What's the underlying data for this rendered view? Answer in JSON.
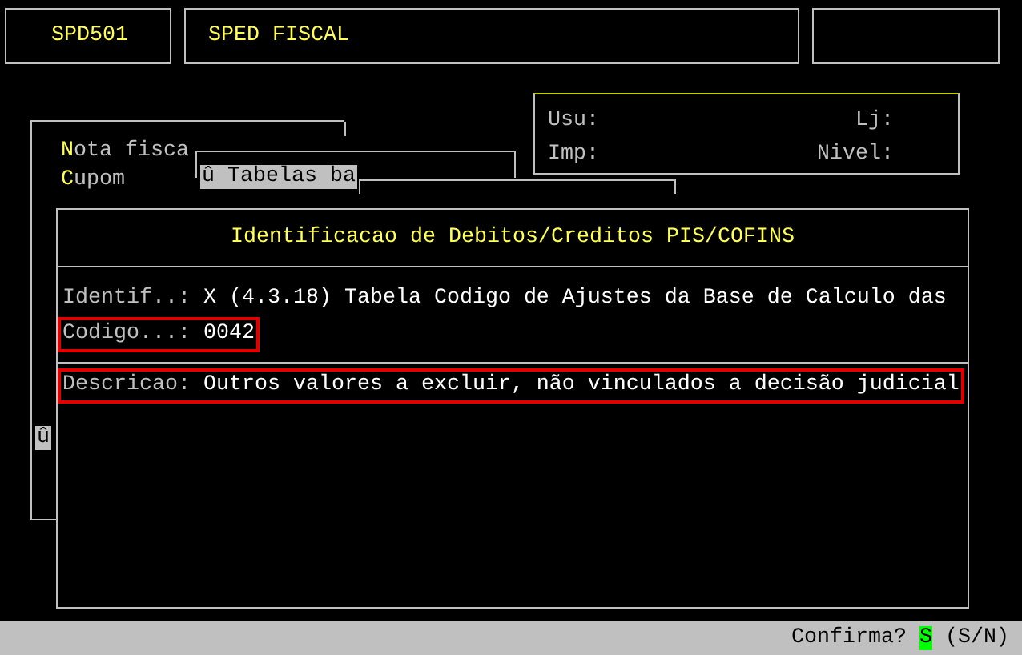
{
  "header": {
    "program_code": "SPD501",
    "program_title": "SPED FISCAL"
  },
  "info_panel": {
    "fields": [
      {
        "label": "Usu:"
      },
      {
        "label": "Lj:"
      },
      {
        "label": "Imp:"
      },
      {
        "label": "Nivel:"
      }
    ]
  },
  "back_menu": {
    "items": [
      "Nota fisca",
      "Cupom"
    ]
  },
  "submenu": {
    "selected_item": "û Tabelas ba"
  },
  "side_marker": "û",
  "dialog": {
    "title": "Identificacao de Debitos/Creditos PIS/COFINS",
    "fields": [
      {
        "label": "Identif..:",
        "value": "X (4.3.18) Tabela Codigo de Ajustes da Base de Calculo das",
        "highlighted": false
      },
      {
        "label": "Codigo...:",
        "value": "0042",
        "highlighted": true
      }
    ],
    "description": {
      "label": "Descricao:",
      "value": "Outros valores a excluir, não vinculados a decisão judicial",
      "highlighted": true
    }
  },
  "status_bar": {
    "prompt": "Confirma?",
    "answer": "S",
    "options": "(S/N)"
  }
}
